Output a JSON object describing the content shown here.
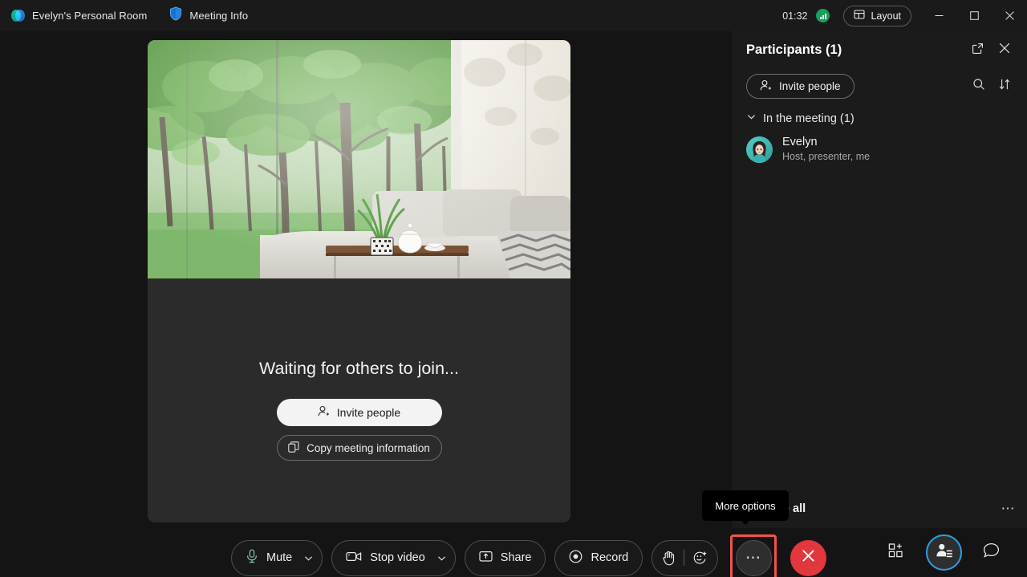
{
  "titlebar": {
    "room_tab": "Evelyn's Personal Room",
    "meeting_info_tab": "Meeting Info",
    "clock": "01:32",
    "layout_label": "Layout",
    "logo_icon": "webex-logo-icon",
    "shield_icon": "shield-icon",
    "network_icon": "network-quality-icon",
    "layout_icon": "layout-grid-icon",
    "minimize_icon": "minimize-icon",
    "maximize_icon": "maximize-icon",
    "close_icon": "close-icon"
  },
  "stage": {
    "waiting_title": "Waiting for others to join...",
    "invite_label": "Invite people",
    "copy_label": "Copy meeting information",
    "invite_icon": "add-person-icon",
    "copy_icon": "copy-icon",
    "video_description": "Virtual background: living room with sofa and forest view through window"
  },
  "panel": {
    "title": "Participants (1)",
    "popout_icon": "pop-out-icon",
    "close_icon": "close-icon",
    "invite_label": "Invite people",
    "invite_icon": "add-person-icon",
    "search_icon": "search-icon",
    "sort_icon": "sort-icon",
    "section_label": "In the meeting (1)",
    "chevron_icon": "chevron-down-icon",
    "participants": [
      {
        "name": "Evelyn",
        "role": "Host, presenter, me",
        "avatar_icon": "avatar-icon"
      }
    ],
    "unmute_all_label": "Unmute all",
    "unmute_more_icon": "more-horizontal-icon"
  },
  "tooltip": {
    "text": "More options"
  },
  "toolbar": {
    "mute_label": "Mute",
    "mute_icon": "microphone-icon",
    "mute_caret_icon": "chevron-down-icon",
    "video_label": "Stop video",
    "video_icon": "camera-icon",
    "video_caret_icon": "chevron-down-icon",
    "share_label": "Share",
    "share_icon": "share-screen-icon",
    "record_label": "Record",
    "record_icon": "record-icon",
    "raise_hand_icon": "raise-hand-icon",
    "reactions_icon": "reactions-icon",
    "more_icon": "more-horizontal-icon",
    "leave_icon": "leave-meeting-icon",
    "apps_icon": "apps-grid-icon",
    "participants_icon": "participants-icon",
    "chat_icon": "chat-icon"
  },
  "colors": {
    "background": "#141414",
    "titlebar": "#1a1a1a",
    "panel": "#1b1b1b",
    "stage_tile": "#2b2b2b",
    "accent_blue": "#2d9ce0",
    "leave_red": "#e2373d",
    "highlight_red": "#f2534d",
    "mic_green": "#83c9a5"
  }
}
